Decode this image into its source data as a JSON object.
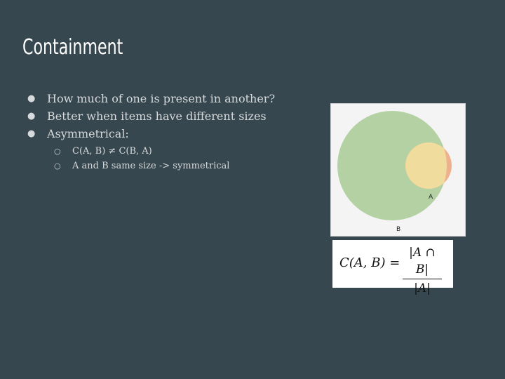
{
  "slide": {
    "title": "Containment",
    "bullets": [
      "How much of one is present in another?",
      "Better when items have different sizes",
      "Asymmetrical:"
    ],
    "sub_bullets": [
      "C(A, B) ≠ C(B, A)",
      "A and B same size -> symmetrical"
    ]
  },
  "venn": {
    "label_a": "A",
    "label_b": "B",
    "colors": {
      "background": "#f4f4f4",
      "set_b": "#b3d1a2",
      "set_a": "#f0dc9c",
      "a_only": "#eeb08e"
    }
  },
  "formula": {
    "lhs": "C(A, B) =",
    "numerator": "|A ∩ B|",
    "denominator": "|A|"
  }
}
